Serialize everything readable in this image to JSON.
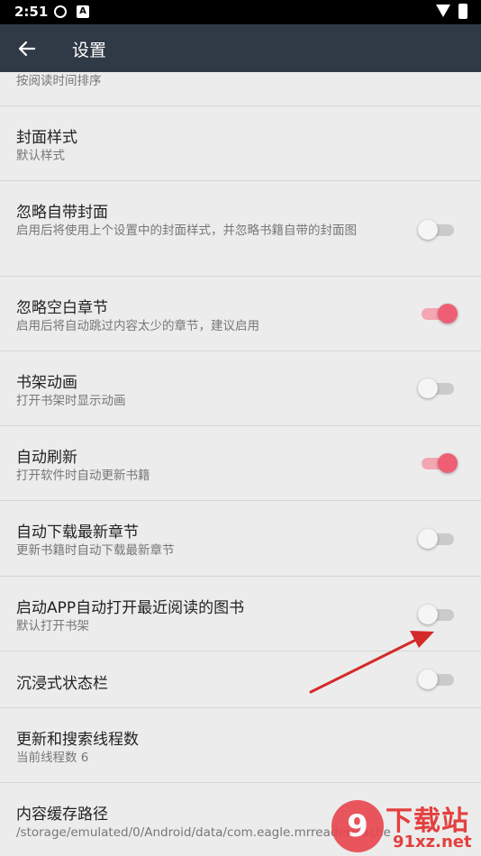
{
  "status_bar": {
    "time": "2:51",
    "notification_icon_letter": "A",
    "icons": [
      "sync-icon",
      "a-notification-icon",
      "wifi-icon",
      "battery-charging-icon"
    ]
  },
  "app_bar": {
    "title": "设置",
    "back_icon": "arrow-left-icon"
  },
  "settings": {
    "sort": {
      "subtitle": "按阅读时间排序"
    },
    "cover_style": {
      "title": "封面样式",
      "subtitle": "默认样式"
    },
    "ignore_builtin_cover": {
      "title": "忽略自带封面",
      "subtitle": "启用后将使用上个设置中的封面样式，并忽略书籍自带的封面图",
      "enabled": false
    },
    "ignore_empty_chapters": {
      "title": "忽略空白章节",
      "subtitle": "启用后将自动跳过内容太少的章节，建议启用",
      "enabled": true
    },
    "shelf_animation": {
      "title": "书架动画",
      "subtitle": "打开书架时显示动画",
      "enabled": false
    },
    "auto_refresh": {
      "title": "自动刷新",
      "subtitle": "打开软件时自动更新书籍",
      "enabled": true
    },
    "auto_download_latest": {
      "title": "自动下载最新章节",
      "subtitle": "更新书籍时自动下载最新章节",
      "enabled": false
    },
    "open_recent_on_launch": {
      "title": "启动APP自动打开最近阅读的图书",
      "subtitle": "默认打开书架",
      "enabled": false
    },
    "immersive_status_bar": {
      "title": "沉浸式状态栏",
      "enabled": false
    },
    "thread_count": {
      "title": "更新和搜索线程数",
      "subtitle": "当前线程数 6"
    },
    "cache_path": {
      "title": "内容缓存路径",
      "subtitle": "/storage/emulated/0/Android/data/com.eagle.mrreader/cache"
    }
  },
  "colors": {
    "app_bar": "#303a46",
    "accent": "#ee5f74",
    "annotation_arrow": "#d42a2a",
    "background": "#ececec"
  },
  "watermark": {
    "logo": "9",
    "text": "下载站",
    "url": "91xz.net"
  }
}
